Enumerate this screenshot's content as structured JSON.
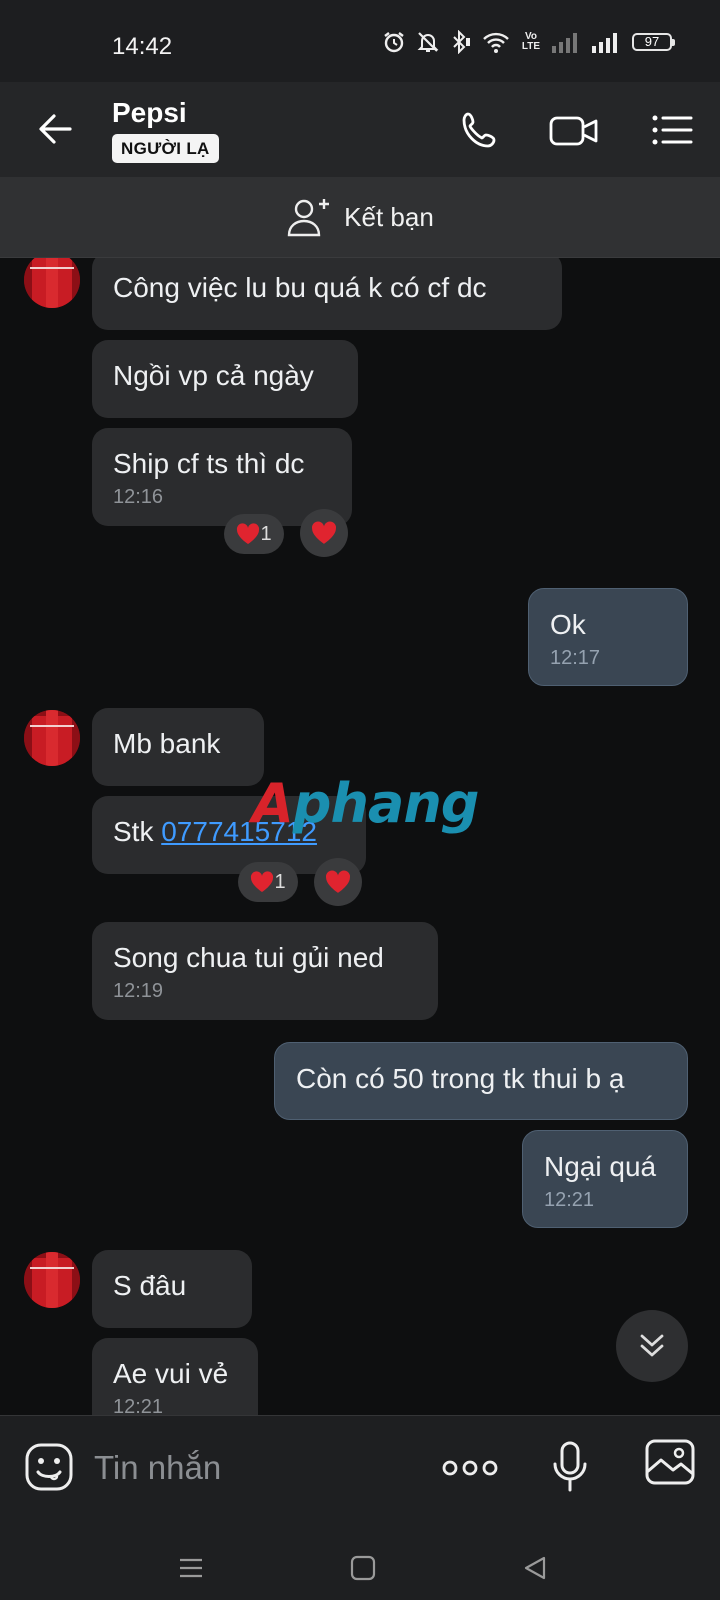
{
  "status_bar": {
    "time": "14:42",
    "network_label": "Vo LTE",
    "battery": "97"
  },
  "header": {
    "contact_name": "Pepsi",
    "badge": "NGƯỜI LẠ"
  },
  "add_friend": {
    "label": "Kết bạn"
  },
  "messages": [
    {
      "dir": "in",
      "text": "Công việc lu bu quá k có cf dc"
    },
    {
      "dir": "in",
      "text": "Ngồi vp cả ngày"
    },
    {
      "dir": "in",
      "text": "Ship cf ts thì dc",
      "time": "12:16",
      "reaction_count": "1"
    },
    {
      "dir": "out",
      "text": "Ok",
      "time": "12:17"
    },
    {
      "dir": "in",
      "text": "Mb bank"
    },
    {
      "dir": "in",
      "text_prefix": "Stk ",
      "link": "0777415712",
      "reaction_count": "1"
    },
    {
      "dir": "in",
      "text": "Song chua tui gủi ned",
      "time": "12:19"
    },
    {
      "dir": "out",
      "text": "Còn có 50 trong tk thui b ạ"
    },
    {
      "dir": "out",
      "text": "Ngại quá",
      "time": "12:21"
    },
    {
      "dir": "in",
      "text": "S đâu"
    },
    {
      "dir": "in",
      "text": "Ae vui vẻ",
      "time": "12:21"
    }
  ],
  "watermark": {
    "part1": "A",
    "part2": "phang"
  },
  "composer": {
    "placeholder": "Tin nhắn"
  },
  "colors": {
    "incoming_bubble": "#2b2c2e",
    "outgoing_bubble": "#3a4653",
    "link": "#3f9bff",
    "heart": "#e0242f"
  },
  "icons": [
    "alarm-icon",
    "mute-icon",
    "bluetooth-icon",
    "wifi-icon",
    "signal-icon",
    "back-arrow-icon",
    "phone-icon",
    "video-call-icon",
    "menu-icon",
    "add-friend-icon",
    "heart-icon",
    "scroll-down-icon",
    "emoji-icon",
    "more-icon",
    "microphone-icon",
    "image-icon",
    "recent-apps-icon",
    "home-icon",
    "back-nav-icon"
  ]
}
